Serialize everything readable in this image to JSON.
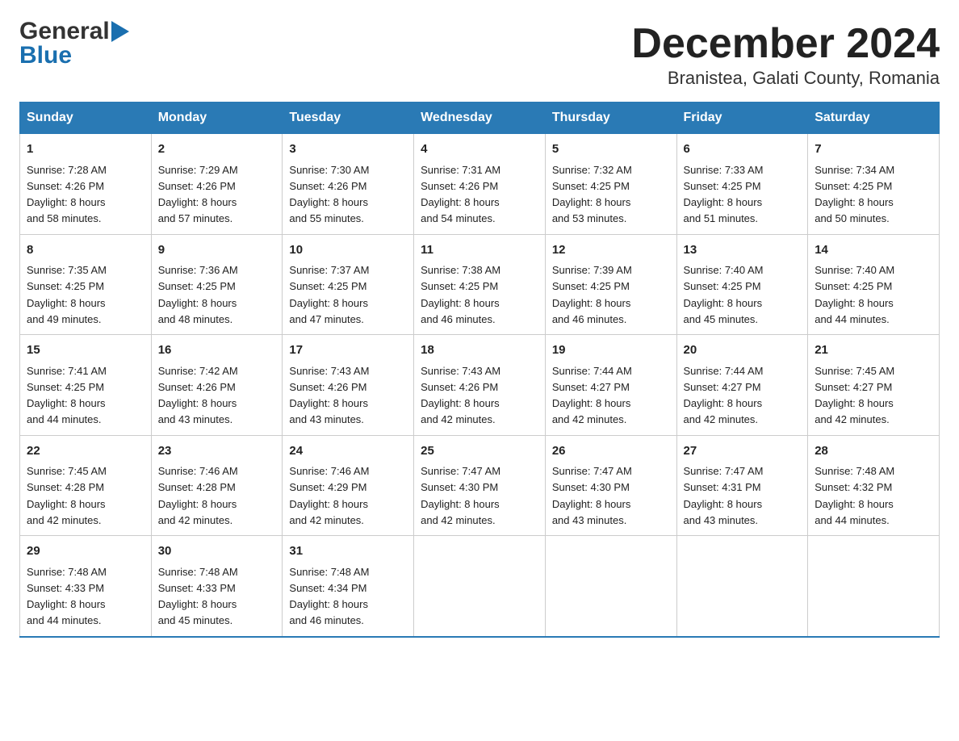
{
  "logo": {
    "line1": "General",
    "line2": "Blue"
  },
  "title": "December 2024",
  "subtitle": "Branistea, Galati County, Romania",
  "weekdays": [
    "Sunday",
    "Monday",
    "Tuesday",
    "Wednesday",
    "Thursday",
    "Friday",
    "Saturday"
  ],
  "weeks": [
    [
      {
        "day": "1",
        "sunrise": "7:28 AM",
        "sunset": "4:26 PM",
        "daylight": "8 hours and 58 minutes."
      },
      {
        "day": "2",
        "sunrise": "7:29 AM",
        "sunset": "4:26 PM",
        "daylight": "8 hours and 57 minutes."
      },
      {
        "day": "3",
        "sunrise": "7:30 AM",
        "sunset": "4:26 PM",
        "daylight": "8 hours and 55 minutes."
      },
      {
        "day": "4",
        "sunrise": "7:31 AM",
        "sunset": "4:26 PM",
        "daylight": "8 hours and 54 minutes."
      },
      {
        "day": "5",
        "sunrise": "7:32 AM",
        "sunset": "4:25 PM",
        "daylight": "8 hours and 53 minutes."
      },
      {
        "day": "6",
        "sunrise": "7:33 AM",
        "sunset": "4:25 PM",
        "daylight": "8 hours and 51 minutes."
      },
      {
        "day": "7",
        "sunrise": "7:34 AM",
        "sunset": "4:25 PM",
        "daylight": "8 hours and 50 minutes."
      }
    ],
    [
      {
        "day": "8",
        "sunrise": "7:35 AM",
        "sunset": "4:25 PM",
        "daylight": "8 hours and 49 minutes."
      },
      {
        "day": "9",
        "sunrise": "7:36 AM",
        "sunset": "4:25 PM",
        "daylight": "8 hours and 48 minutes."
      },
      {
        "day": "10",
        "sunrise": "7:37 AM",
        "sunset": "4:25 PM",
        "daylight": "8 hours and 47 minutes."
      },
      {
        "day": "11",
        "sunrise": "7:38 AM",
        "sunset": "4:25 PM",
        "daylight": "8 hours and 46 minutes."
      },
      {
        "day": "12",
        "sunrise": "7:39 AM",
        "sunset": "4:25 PM",
        "daylight": "8 hours and 46 minutes."
      },
      {
        "day": "13",
        "sunrise": "7:40 AM",
        "sunset": "4:25 PM",
        "daylight": "8 hours and 45 minutes."
      },
      {
        "day": "14",
        "sunrise": "7:40 AM",
        "sunset": "4:25 PM",
        "daylight": "8 hours and 44 minutes."
      }
    ],
    [
      {
        "day": "15",
        "sunrise": "7:41 AM",
        "sunset": "4:25 PM",
        "daylight": "8 hours and 44 minutes."
      },
      {
        "day": "16",
        "sunrise": "7:42 AM",
        "sunset": "4:26 PM",
        "daylight": "8 hours and 43 minutes."
      },
      {
        "day": "17",
        "sunrise": "7:43 AM",
        "sunset": "4:26 PM",
        "daylight": "8 hours and 43 minutes."
      },
      {
        "day": "18",
        "sunrise": "7:43 AM",
        "sunset": "4:26 PM",
        "daylight": "8 hours and 42 minutes."
      },
      {
        "day": "19",
        "sunrise": "7:44 AM",
        "sunset": "4:27 PM",
        "daylight": "8 hours and 42 minutes."
      },
      {
        "day": "20",
        "sunrise": "7:44 AM",
        "sunset": "4:27 PM",
        "daylight": "8 hours and 42 minutes."
      },
      {
        "day": "21",
        "sunrise": "7:45 AM",
        "sunset": "4:27 PM",
        "daylight": "8 hours and 42 minutes."
      }
    ],
    [
      {
        "day": "22",
        "sunrise": "7:45 AM",
        "sunset": "4:28 PM",
        "daylight": "8 hours and 42 minutes."
      },
      {
        "day": "23",
        "sunrise": "7:46 AM",
        "sunset": "4:28 PM",
        "daylight": "8 hours and 42 minutes."
      },
      {
        "day": "24",
        "sunrise": "7:46 AM",
        "sunset": "4:29 PM",
        "daylight": "8 hours and 42 minutes."
      },
      {
        "day": "25",
        "sunrise": "7:47 AM",
        "sunset": "4:30 PM",
        "daylight": "8 hours and 42 minutes."
      },
      {
        "day": "26",
        "sunrise": "7:47 AM",
        "sunset": "4:30 PM",
        "daylight": "8 hours and 43 minutes."
      },
      {
        "day": "27",
        "sunrise": "7:47 AM",
        "sunset": "4:31 PM",
        "daylight": "8 hours and 43 minutes."
      },
      {
        "day": "28",
        "sunrise": "7:48 AM",
        "sunset": "4:32 PM",
        "daylight": "8 hours and 44 minutes."
      }
    ],
    [
      {
        "day": "29",
        "sunrise": "7:48 AM",
        "sunset": "4:33 PM",
        "daylight": "8 hours and 44 minutes."
      },
      {
        "day": "30",
        "sunrise": "7:48 AM",
        "sunset": "4:33 PM",
        "daylight": "8 hours and 45 minutes."
      },
      {
        "day": "31",
        "sunrise": "7:48 AM",
        "sunset": "4:34 PM",
        "daylight": "8 hours and 46 minutes."
      },
      null,
      null,
      null,
      null
    ]
  ],
  "labels": {
    "sunrise": "Sunrise:",
    "sunset": "Sunset:",
    "daylight": "Daylight:"
  }
}
